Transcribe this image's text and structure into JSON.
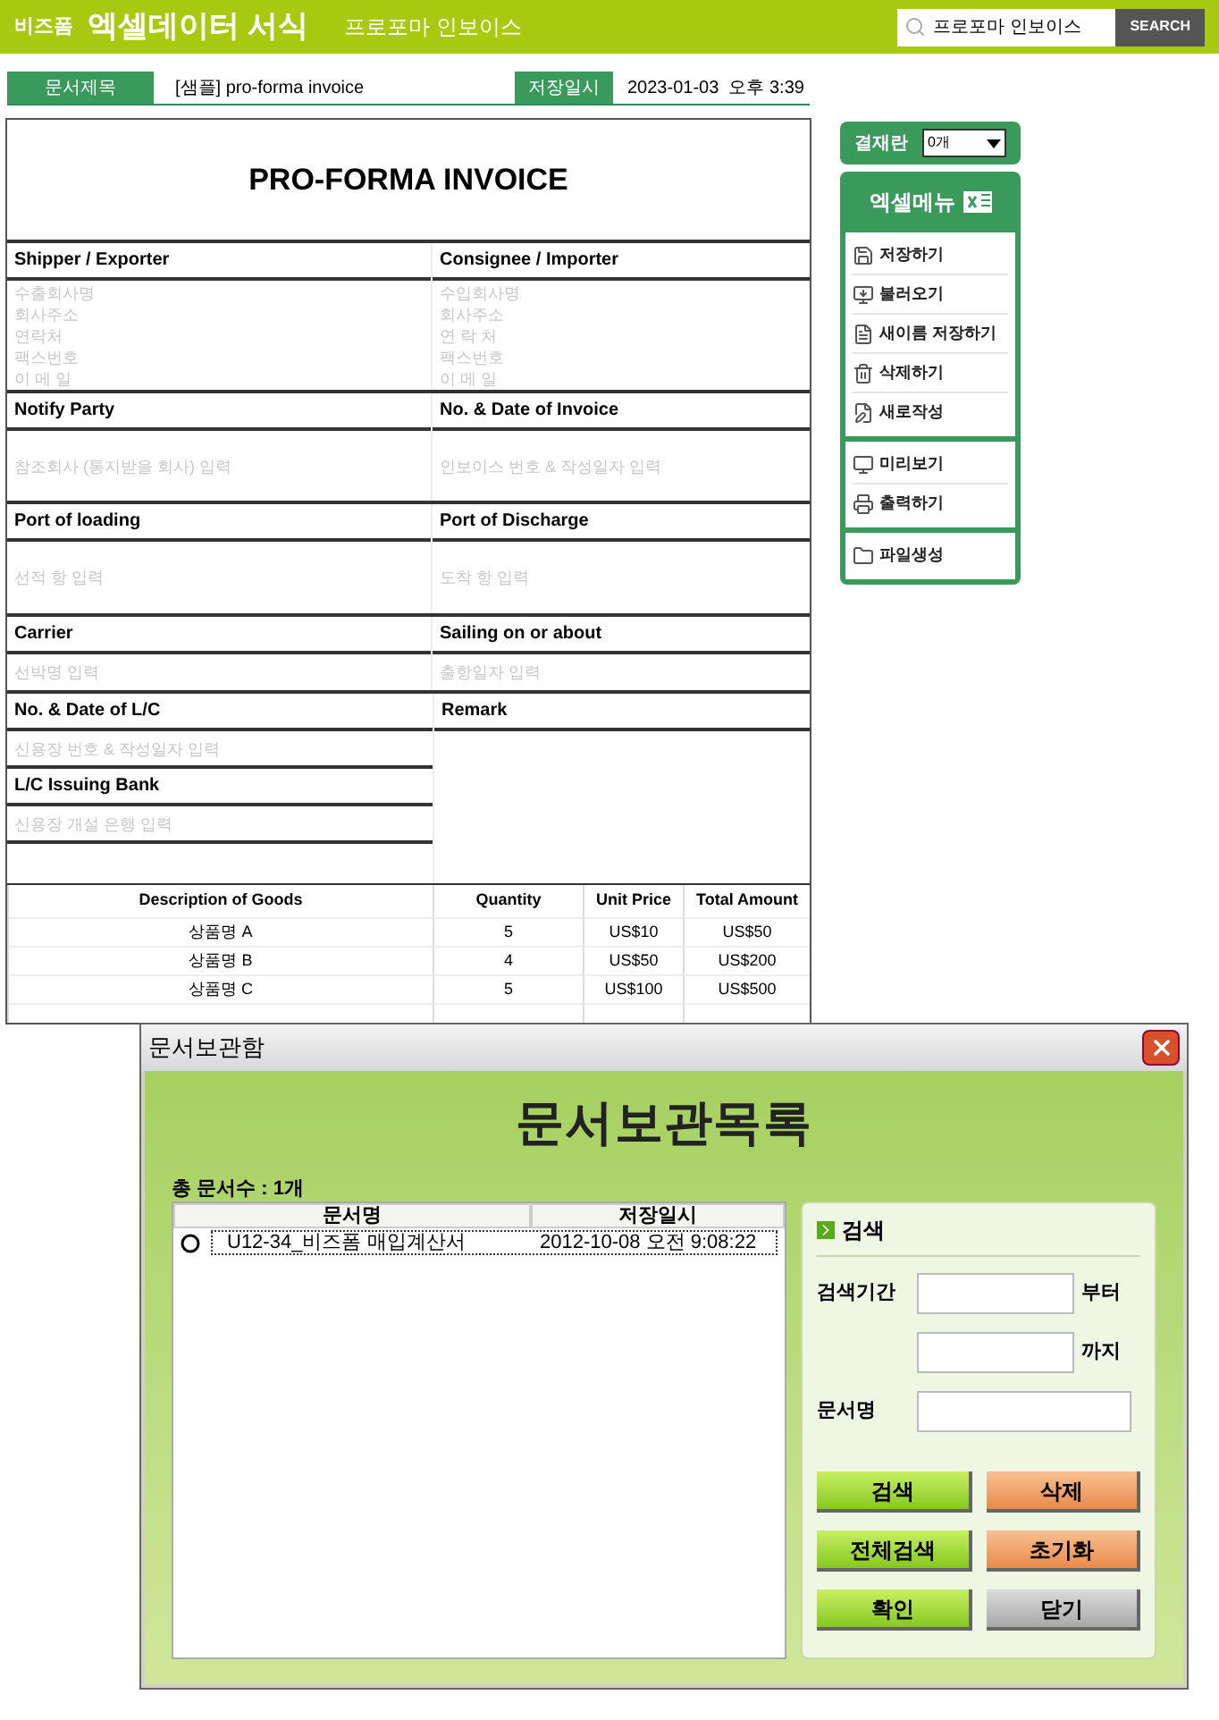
{
  "header": {
    "logo": "비즈폼",
    "title": "엑셀데이터 서식",
    "subtitle": "프로포마 인보이스",
    "search_value": "프로포마 인보이스",
    "search_button": "SEARCH"
  },
  "doc_bar": {
    "title_label": "문서제목",
    "title_value": "[샘플] pro-forma invoice",
    "saved_label": "저장일시",
    "saved_value": "2023-01-03  오후 3:39"
  },
  "invoice": {
    "heading": "PRO-FORMA INVOICE",
    "rows": [
      {
        "cells": [
          {
            "label": "Shipper / Exporter",
            "lines": [
              "수출회사명",
              "회사주소",
              "연락처",
              "팩스번호",
              "이 메 일"
            ]
          },
          {
            "label": "Consignee / Importer",
            "lines": [
              "수입회사명",
              "회사주소",
              "연 락 처",
              "팩스번호",
              "이 메 일"
            ]
          }
        ]
      },
      {
        "cells": [
          {
            "label": "Notify Party",
            "lines": [
              "참조회사 (통지받을 회사) 입력"
            ]
          },
          {
            "label": "No. & Date of Invoice",
            "lines": [
              "인보이스 번호 & 작성일자 입력"
            ]
          }
        ]
      },
      {
        "cells": [
          {
            "label": "Port of loading",
            "lines": [
              "선적 항 입력"
            ]
          },
          {
            "label": "Port of Discharge",
            "lines": [
              "도착 항 입력"
            ]
          }
        ]
      },
      {
        "cells": [
          {
            "label": "Carrier",
            "lines": [
              "선박명 입력"
            ]
          },
          {
            "label": "Sailing on or about",
            "lines": [
              "출항일자 입력"
            ]
          }
        ]
      }
    ],
    "lc": [
      {
        "label": "No. & Date of L/C",
        "lines": [
          "신용장 번호 & 작성일자 입력"
        ]
      },
      {
        "label": "L/C Issuing Bank",
        "lines": [
          "신용장 개설 은행 입력"
        ]
      }
    ],
    "remark": {
      "label": "Remark"
    },
    "goods": {
      "columns": [
        "Description of Goods",
        "Quantity",
        "Unit Price",
        "Total Amount"
      ],
      "rows": [
        [
          "상품명 A",
          "5",
          "US$10",
          "US$50"
        ],
        [
          "상품명 B",
          "4",
          "US$50",
          "US$200"
        ],
        [
          "상품명 C",
          "5",
          "US$100",
          "US$500"
        ]
      ]
    }
  },
  "approval": {
    "label": "결재란",
    "value": "0개"
  },
  "menu": {
    "title": "엑셀메뉴",
    "groups": [
      [
        {
          "label": "저장하기",
          "kind": "save"
        },
        {
          "label": "불러오기",
          "kind": "load"
        },
        {
          "label": "새이름 저장하기",
          "kind": "saveas"
        },
        {
          "label": "삭제하기",
          "kind": "delete"
        },
        {
          "label": "새로작성",
          "kind": "new"
        }
      ],
      [
        {
          "label": "미리보기",
          "kind": "preview"
        },
        {
          "label": "출력하기",
          "kind": "print"
        }
      ],
      [
        {
          "label": "파일생성",
          "kind": "folder"
        }
      ]
    ]
  },
  "dialog": {
    "title": "문서보관함",
    "heading": "문서보관목록",
    "count": "총 문서수 : 1개",
    "columns": [
      "문서명",
      "저장일시"
    ],
    "rows": [
      {
        "name": "U12-34_비즈폼 매입계산서",
        "date": "2012-10-08 오전 9:08:22",
        "selected": false
      }
    ],
    "search": {
      "title": "검색",
      "fields": [
        {
          "label": "검색기간",
          "suffix": "부터"
        },
        {
          "suffix": "까지"
        },
        {
          "label": "문서명"
        }
      ],
      "buttons": [
        {
          "label": "검색",
          "kind": "go"
        },
        {
          "label": "삭제",
          "kind": "warn"
        },
        {
          "label": "전체검색",
          "kind": "go"
        },
        {
          "label": "초기화",
          "kind": "warn"
        },
        {
          "label": "확인",
          "kind": "go"
        },
        {
          "label": "닫기",
          "kind": "neutral"
        }
      ]
    }
  }
}
